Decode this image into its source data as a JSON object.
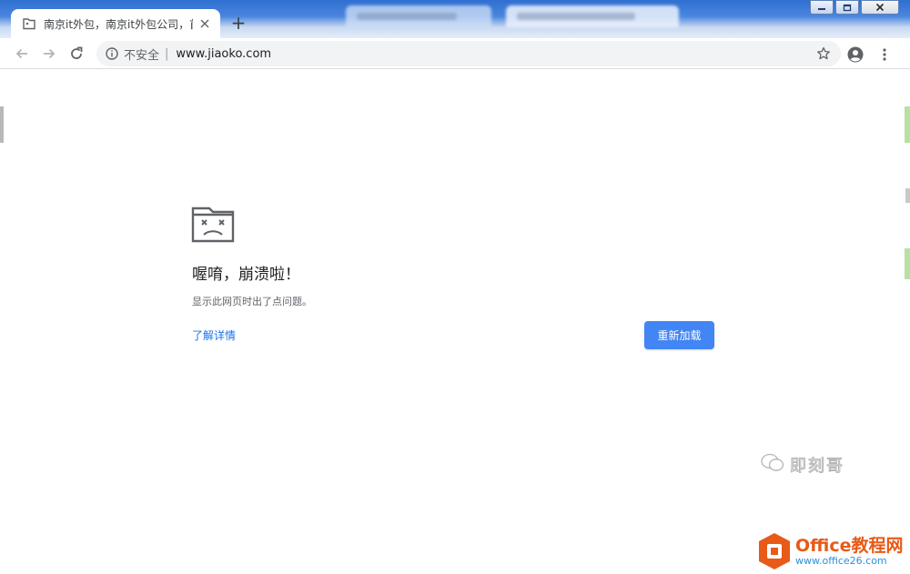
{
  "browser": {
    "active_tab": {
      "title": "南京it外包，南京it外包公司，首",
      "favicon": "broken-page-icon"
    },
    "new_tab_label": "+",
    "window_controls": [
      "minimize-icon",
      "restore-icon",
      "close-icon"
    ]
  },
  "toolbar": {
    "security_label": "不安全",
    "security_separator": "|",
    "url": "www.jiaoko.com"
  },
  "error_page": {
    "icon": "sad-tab-icon",
    "title": "喔唷，崩溃啦！",
    "description": "显示此网页时出了点问题。",
    "learn_more": "了解详情",
    "reload_button": "重新加载",
    "accent_color": "#4285f4"
  },
  "watermarks": {
    "wechat_account": "即刻哥",
    "site_name": "Office教程网",
    "site_url": "www.office26.com"
  }
}
